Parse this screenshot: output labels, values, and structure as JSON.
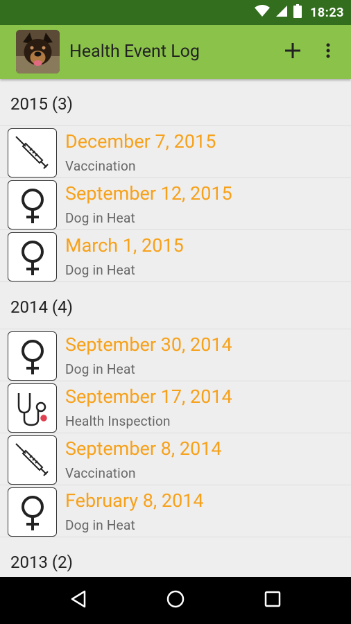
{
  "status_bar": {
    "time": "18:23"
  },
  "app_bar": {
    "title": "Health Event Log"
  },
  "groups": [
    {
      "header": "2015 (3)",
      "events": [
        {
          "date": "December 7, 2015",
          "type": "Vaccination",
          "icon": "syringe-icon"
        },
        {
          "date": "September 12, 2015",
          "type": "Dog in Heat",
          "icon": "female-symbol-icon"
        },
        {
          "date": "March 1, 2015",
          "type": "Dog in Heat",
          "icon": "female-symbol-icon"
        }
      ]
    },
    {
      "header": "2014 (4)",
      "events": [
        {
          "date": "September 30, 2014",
          "type": "Dog in Heat",
          "icon": "female-symbol-icon"
        },
        {
          "date": "September 17, 2014",
          "type": "Health Inspection",
          "icon": "stethoscope-icon"
        },
        {
          "date": "September 8, 2014",
          "type": "Vaccination",
          "icon": "syringe-icon"
        },
        {
          "date": "February 8, 2014",
          "type": "Dog in Heat",
          "icon": "female-symbol-icon"
        }
      ]
    },
    {
      "header": "2013 (2)",
      "events": []
    }
  ],
  "colors": {
    "status_bar": "#336e1f",
    "app_bar": "#8bc34a",
    "date_text": "#f7a11a",
    "background": "#eeeeee"
  }
}
